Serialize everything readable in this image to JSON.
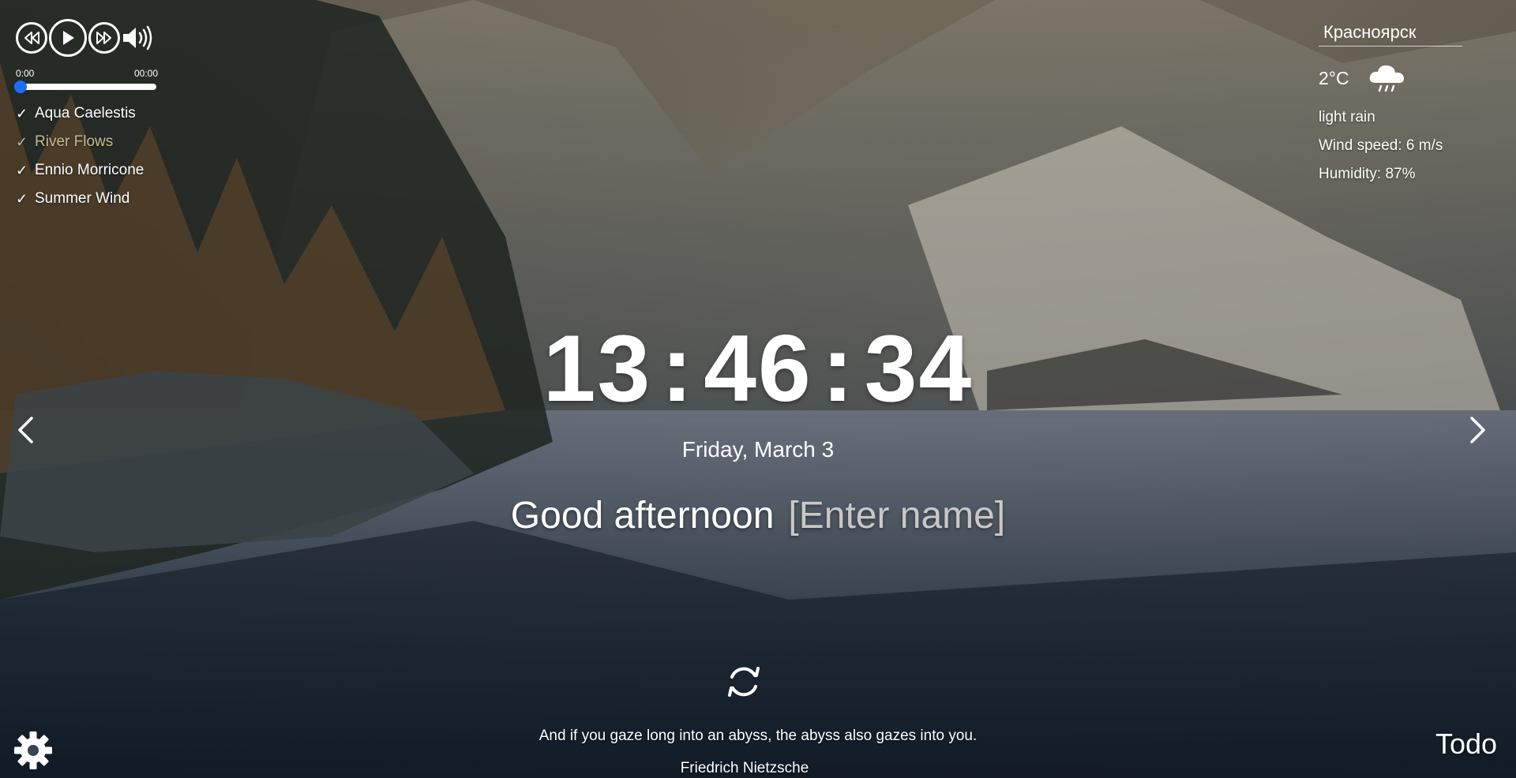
{
  "player": {
    "current_time": "0:00",
    "duration": "00:00",
    "progress": 0.03,
    "playlist": [
      {
        "title": "Aqua Caelestis",
        "active": false
      },
      {
        "title": "River Flows",
        "active": true
      },
      {
        "title": "Ennio Morricone",
        "active": false
      },
      {
        "title": "Summer Wind",
        "active": false
      }
    ],
    "tick": "✓"
  },
  "weather": {
    "city": "Красноярск",
    "temperature": "2°C",
    "icon": "rain-cloud-icon",
    "description": "light rain",
    "wind": "Wind speed: 6 m/s",
    "humidity": "Humidity: 87%"
  },
  "clock": {
    "hours": "13",
    "minutes": "46",
    "seconds": "34",
    "separator": ":"
  },
  "date": "Friday, March 3",
  "greeting": {
    "text": "Good afternoon",
    "name_placeholder": "[Enter name]"
  },
  "quote": {
    "text": "And if you gaze long into an abyss, the abyss also gazes into you.",
    "author": "Friedrich Nietzsche"
  },
  "todo_label": "Todo",
  "colors": {
    "accent": "#1d6ff2",
    "active_track": "#c9b992"
  }
}
